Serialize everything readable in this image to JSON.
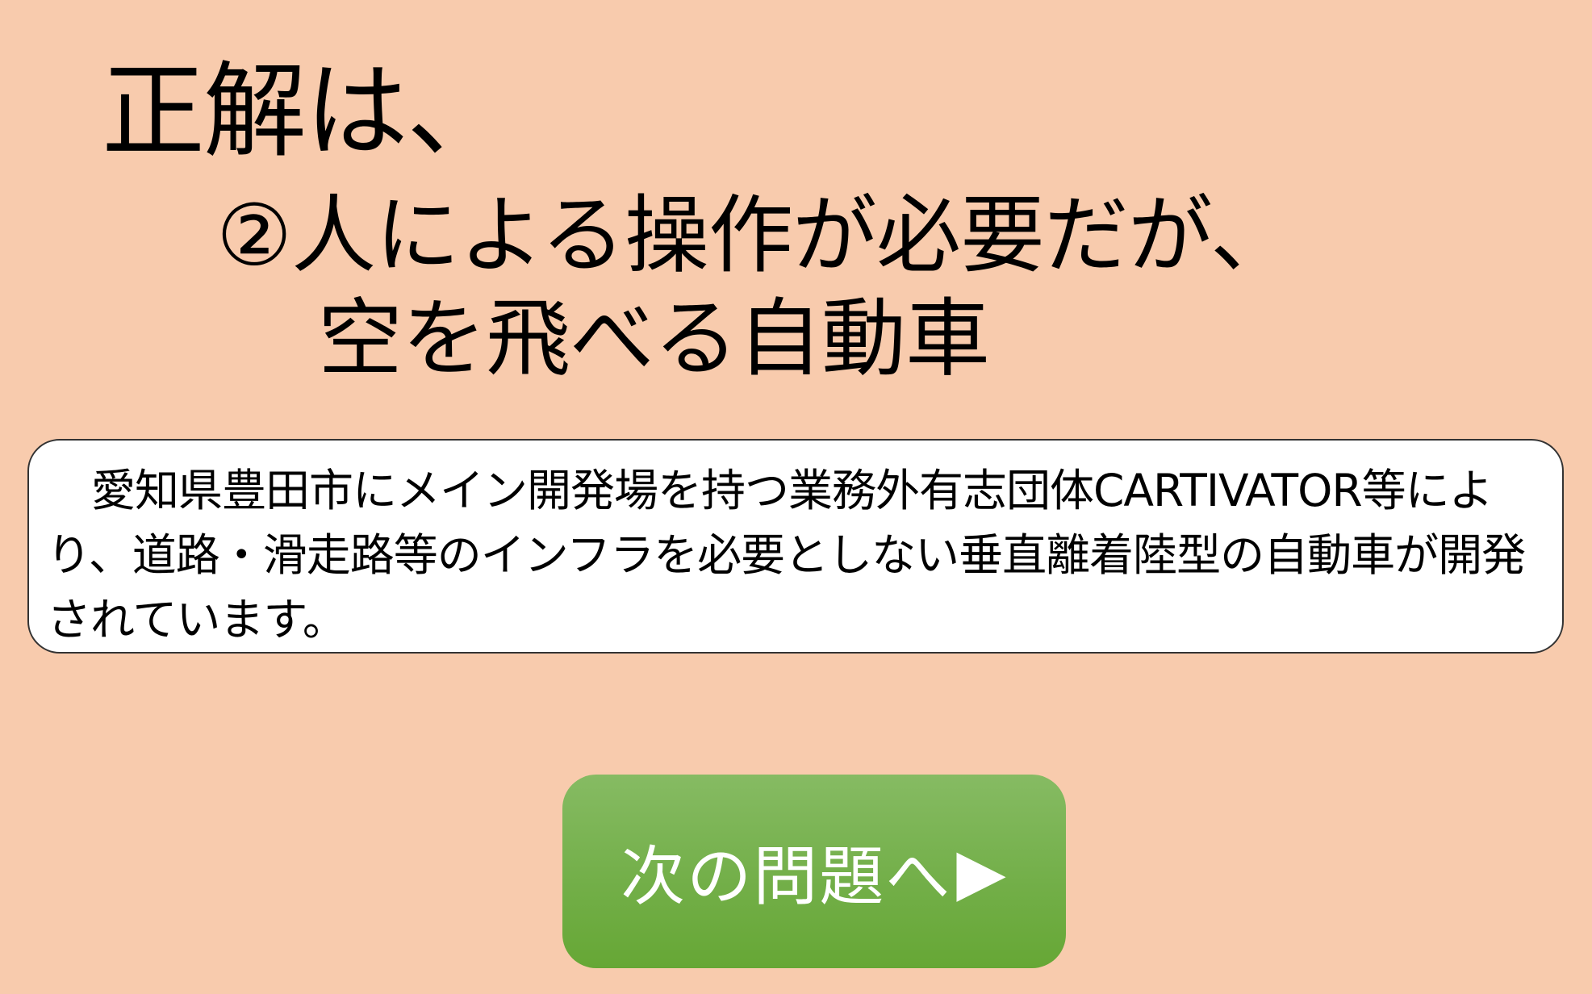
{
  "heading": {
    "prefix": "正解は、"
  },
  "answer": {
    "line1": "②人による操作が必要だが、",
    "line2": "空を飛べる自動車"
  },
  "explanation": {
    "text": "愛知県豊田市にメイン開発場を持つ業務外有志団体CARTIVATOR等により、道路・滑走路等のインフラを必要としない垂直離着陸型の自動車が開発されています。"
  },
  "next_button": {
    "label": "次の問題へ",
    "arrow": "▶"
  },
  "colors": {
    "background": "#F8CBAD",
    "button_green": "#70AD47",
    "box_fill": "#FFFFFF"
  }
}
